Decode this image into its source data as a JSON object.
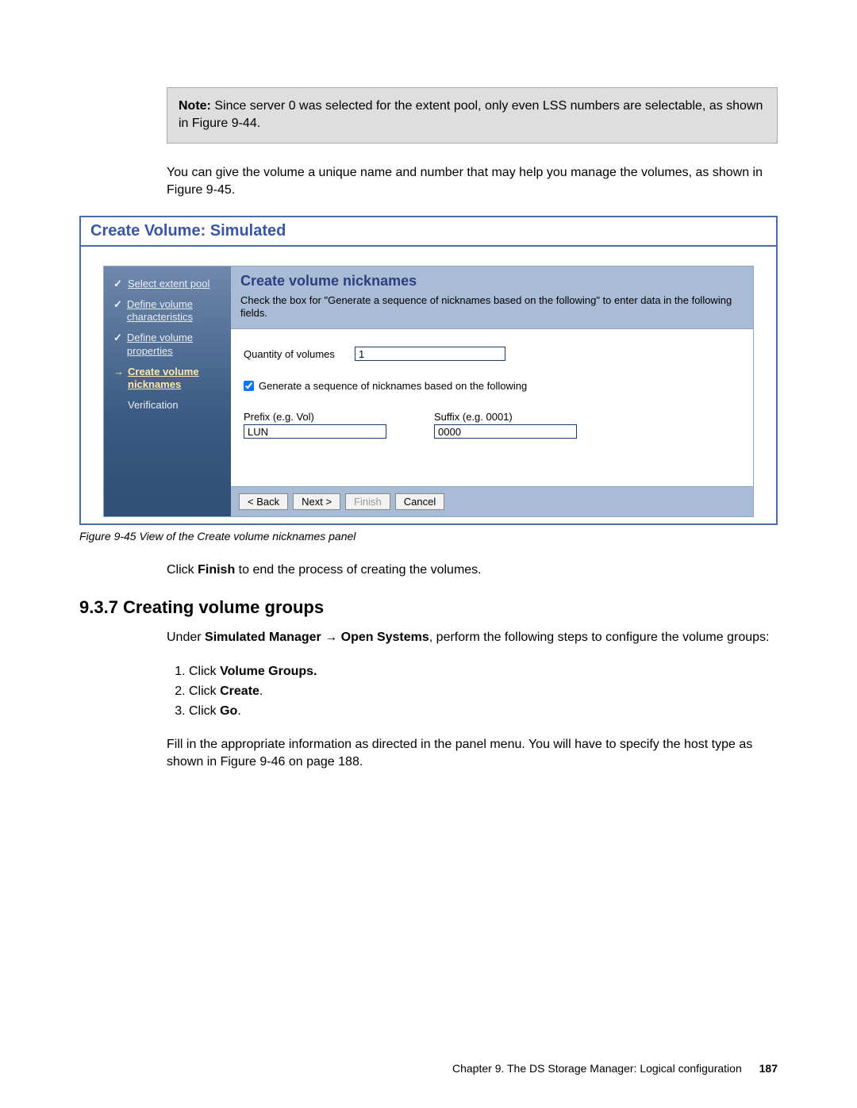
{
  "note": {
    "label": "Note:",
    "text": " Since server 0 was selected for the extent pool, only even LSS numbers are selectable, as shown in Figure 9-44."
  },
  "para1": "You can give the volume a unique name and number that may help you manage the volumes, as shown in Figure 9-45.",
  "figure": {
    "title": "Create Volume: Simulated",
    "steps": {
      "s1": "Select extent pool",
      "s2": "Define volume characteristics",
      "s3": "Define volume properties",
      "s4": "Create volume nicknames",
      "s5": "Verification"
    },
    "header": {
      "title": "Create volume nicknames",
      "desc": "Check the box for \"Generate a sequence of nicknames based on the following\" to enter data in the following fields."
    },
    "fields": {
      "qty_label": "Quantity of volumes",
      "qty_value": "1",
      "gen_label": "Generate a sequence of nicknames based on the following",
      "prefix_label": "Prefix (e.g. Vol)",
      "prefix_value": "LUN",
      "suffix_label": "Suffix (e.g. 0001)",
      "suffix_value": "0000"
    },
    "buttons": {
      "back": "< Back",
      "next": "Next >",
      "finish": "Finish",
      "cancel": "Cancel"
    }
  },
  "caption": "Figure 9-45   View of the Create volume nicknames panel",
  "para2_pre": "Click ",
  "para2_b": "Finish",
  "para2_post": " to end the process of creating the volumes.",
  "section_heading": "9.3.7  Creating volume groups",
  "para3_pre": "Under ",
  "para3_b1": "Simulated Manager",
  "para3_arrow": "  →  ",
  "para3_b2": "Open Systems",
  "para3_post": ", perform the following steps to configure the volume groups:",
  "steps": {
    "s1_pre": "Click ",
    "s1_b": "Volume Groups.",
    "s2_pre": "Click ",
    "s2_b": "Create",
    "s2_post": ".",
    "s3_pre": "Click ",
    "s3_b": "Go",
    "s3_post": "."
  },
  "para4": "Fill in the appropriate information as directed in the panel menu. You will have to specify the host type as shown in Figure 9-46 on page 188.",
  "footer": {
    "chapter": "Chapter 9. The DS Storage Manager: Logical configuration",
    "page": "187"
  }
}
